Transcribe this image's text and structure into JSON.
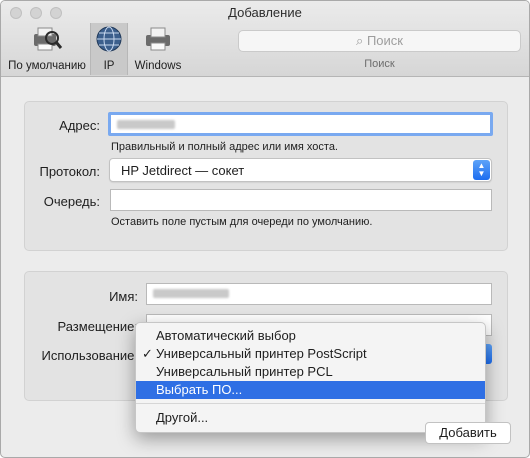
{
  "window": {
    "title": "Добавление"
  },
  "toolbar": {
    "items": [
      {
        "label": "По умолчанию",
        "icon": "printer-magnifier-icon"
      },
      {
        "label": "IP",
        "icon": "globe-icon"
      },
      {
        "label": "Windows",
        "icon": "printer-icon"
      }
    ],
    "search_placeholder": "Поиск",
    "search_caption": "Поиск"
  },
  "form": {
    "address_label": "Адрес:",
    "address_hint": "Правильный и полный адрес или имя хоста.",
    "protocol_label": "Протокол:",
    "protocol_value": "HP Jetdirect — сокет",
    "queue_label": "Очередь:",
    "queue_hint": "Оставить поле пустым для очереди по умолчанию.",
    "name_label": "Имя:",
    "location_label": "Размещение:",
    "use_label": "Использование:"
  },
  "use_menu": {
    "items": [
      {
        "label": "Автоматический выбор",
        "checked": false
      },
      {
        "label": "Универсальный принтер PostScript",
        "checked": true
      },
      {
        "label": "Универсальный принтер PCL",
        "checked": false
      },
      {
        "label": "Выбрать ПО...",
        "checked": false,
        "highlighted": true
      },
      {
        "label": "Другой...",
        "checked": false
      }
    ],
    "check_glyph": "✓"
  },
  "actions": {
    "add_label": "Добавить"
  },
  "colors": {
    "accent": "#2f6fe4",
    "focus_ring": "#79a9f0"
  }
}
